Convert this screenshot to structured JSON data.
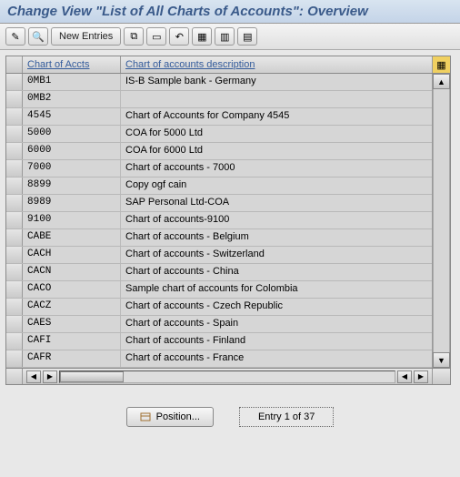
{
  "title": "Change View \"List of All Charts of Accounts\": Overview",
  "toolbar": {
    "new_entries": "New Entries"
  },
  "table": {
    "col_code": "Chart of Accts",
    "col_desc": "Chart of accounts description",
    "rows": [
      {
        "code": "0MB1",
        "desc": "IS-B Sample bank - Germany"
      },
      {
        "code": "0MB2",
        "desc": ""
      },
      {
        "code": "4545",
        "desc": "Chart of Accounts for Company 4545"
      },
      {
        "code": "5000",
        "desc": "COA for 5000 Ltd"
      },
      {
        "code": "6000",
        "desc": "COA for 6000 Ltd"
      },
      {
        "code": "7000",
        "desc": "Chart of accounts - 7000"
      },
      {
        "code": "8899",
        "desc": "Copy ogf cain"
      },
      {
        "code": "8989",
        "desc": "SAP Personal Ltd-COA"
      },
      {
        "code": "9100",
        "desc": "Chart of accounts-9100"
      },
      {
        "code": "CABE",
        "desc": "Chart of accounts - Belgium"
      },
      {
        "code": "CACH",
        "desc": "Chart of accounts - Switzerland"
      },
      {
        "code": "CACN",
        "desc": "Chart of accounts - China"
      },
      {
        "code": "CACO",
        "desc": "Sample chart of accounts for Colombia"
      },
      {
        "code": "CACZ",
        "desc": "Chart of accounts - Czech Republic"
      },
      {
        "code": "CAES",
        "desc": "Chart of accounts - Spain"
      },
      {
        "code": "CAFI",
        "desc": "Chart of accounts - Finland"
      },
      {
        "code": "CAFR",
        "desc": "Chart of accounts - France"
      }
    ]
  },
  "footer": {
    "position": "Position...",
    "entry": "Entry 1 of 37"
  }
}
